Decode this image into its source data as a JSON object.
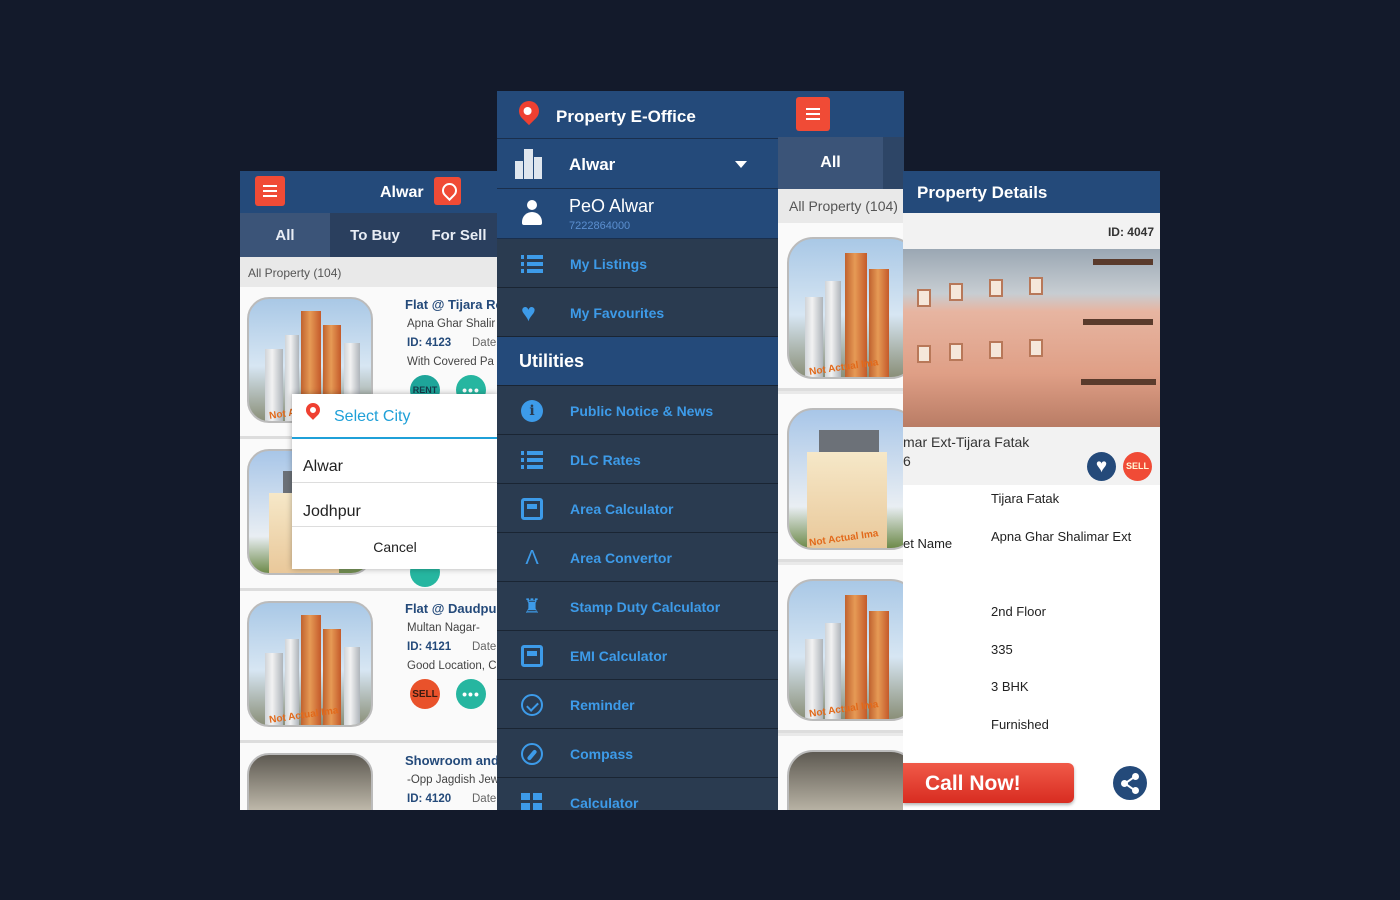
{
  "listing_screen": {
    "city": "Alwar",
    "tabs": [
      "All",
      "To Buy",
      "For Sell"
    ],
    "count_label": "All Property (104)",
    "listings": [
      {
        "title": "Flat @ Tijara Ro",
        "sub": "Apna Ghar Shalir",
        "id": "ID: 4123",
        "date": "Date",
        "desc": "With Covered Pa",
        "badge": "RENT",
        "more": "•••"
      },
      {
        "title": "",
        "sub": "",
        "id": "",
        "date": "",
        "desc": "",
        "badge": "",
        "more": ""
      },
      {
        "title": "Flat @ Daudpur",
        "sub": "Multan Nagar-",
        "id": "ID: 4121",
        "date": "Date",
        "desc": "Good Location, C",
        "badge": "SELL",
        "more": "•••"
      },
      {
        "title": "Showroom and",
        "sub": "-Opp Jagdish Jew",
        "id": "ID: 4120",
        "date": "Date",
        "desc": "",
        "badge": "",
        "more": ""
      }
    ],
    "ribbon": "Not Actual Ima",
    "select_city_dialog": {
      "title": "Select City",
      "options": [
        "Alwar",
        "Jodhpur"
      ],
      "cancel": "Cancel"
    }
  },
  "drawer": {
    "brand": "Property E-Office",
    "city": "Alwar",
    "user_name": "PeO Alwar",
    "user_phone": "7222864000",
    "items": [
      {
        "label": "My Listings",
        "icon": "list-icon"
      },
      {
        "label": "My Favourites",
        "icon": "heart-icon"
      }
    ],
    "section": "Utilities",
    "utilities": [
      {
        "label": "Public Notice & News",
        "icon": "info-icon"
      },
      {
        "label": "DLC Rates",
        "icon": "list-icon"
      },
      {
        "label": "Area Calculator",
        "icon": "calculator-icon"
      },
      {
        "label": "Area Convertor",
        "icon": "drafting-compass-icon"
      },
      {
        "label": "Stamp Duty Calculator",
        "icon": "stamp-icon"
      },
      {
        "label": "EMI Calculator",
        "icon": "calculator-icon"
      },
      {
        "label": "Reminder",
        "icon": "check-circle-icon"
      },
      {
        "label": "Compass",
        "icon": "compass-icon"
      },
      {
        "label": "Calculator",
        "icon": "calculator-grid-icon"
      }
    ]
  },
  "all_screen": {
    "tab": "All",
    "count_label": "All Property (104)",
    "ribbon": "Not Actual Ima"
  },
  "details_screen": {
    "title": "Property Details",
    "id": "ID: 4047",
    "address_line1": "mar Ext-Tijara Fatak",
    "address_line2": "6",
    "sell_badge": "SELL",
    "fields": [
      {
        "label": "",
        "value": "Tijara Fatak"
      },
      {
        "label": "et Name",
        "value": "Apna Ghar Shalimar Ext"
      },
      {
        "label": "",
        "value": "2nd Floor"
      },
      {
        "label": "",
        "value": "335"
      },
      {
        "label": "",
        "value": "3 BHK"
      },
      {
        "label": "",
        "value": "Furnished"
      }
    ],
    "call_label": "Call Now!"
  },
  "colors": {
    "background": "#131a2b",
    "header_blue": "#244a7a",
    "accent_red": "#f04b36",
    "drawer_bg": "#2a3b50",
    "link_blue": "#3d9be9"
  }
}
